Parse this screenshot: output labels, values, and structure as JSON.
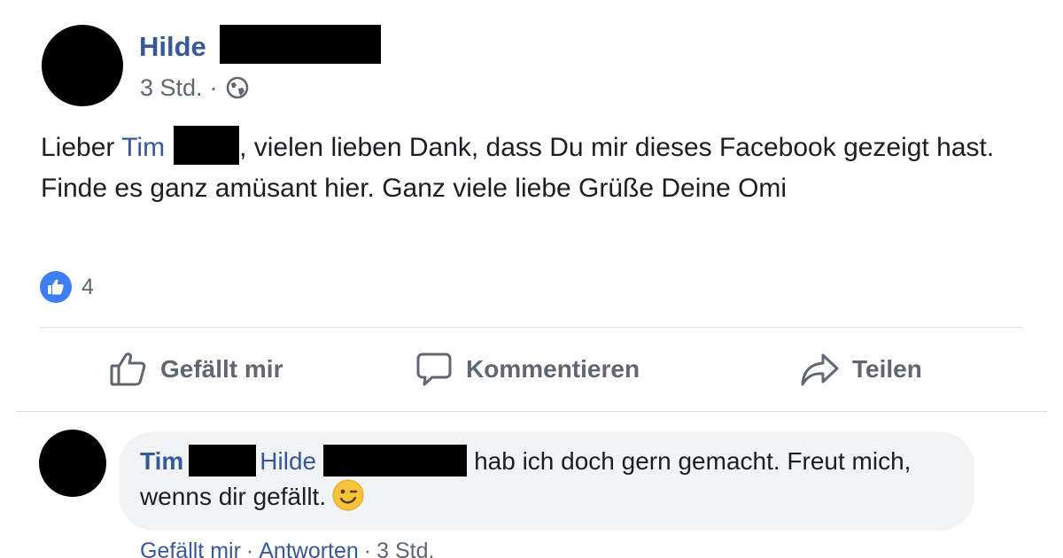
{
  "post": {
    "author_first_name": "Hilde",
    "timestamp": "3 Std.",
    "separator": "·",
    "privacy_icon": "globe-icon",
    "text_part1": "Lieber ",
    "mention_name": "Tim",
    "text_part2": ", vielen lieben Dank, dass Du mir dieses Facebook gezeigt hast. Finde es ganz amüsant hier. Ganz viele liebe Grüße Deine Omi"
  },
  "reactions": {
    "icon": "like-icon",
    "count": "4"
  },
  "actions": {
    "like_label": "Gefällt mir",
    "comment_label": "Kommentieren",
    "share_label": "Teilen"
  },
  "comment": {
    "author_first_name": "Tim",
    "mention_name": "Hilde",
    "text": "hab ich doch gern gemacht. Freut mich, wenns dir gefällt.",
    "emoji": "winking-face-icon",
    "like_label": "Gefällt mir",
    "reply_label": "Antworten",
    "separator": "·",
    "timestamp": "3 Std."
  },
  "colors": {
    "link_blue": "#385898",
    "like_blue": "#3d7ef5",
    "meta_gray": "#606770",
    "bubble_bg": "#f2f3f5"
  }
}
